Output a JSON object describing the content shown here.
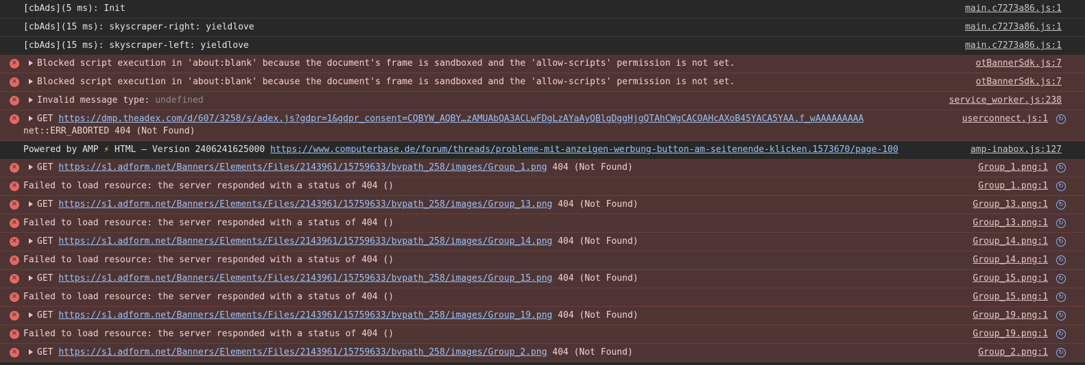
{
  "rows": [
    {
      "text": "[cbAds](5 ms): Init",
      "source": "main.c7273a86.js:1"
    },
    {
      "text": "[cbAds](15 ms): skyscraper-right: yieldlove",
      "source": "main.c7273a86.js:1"
    },
    {
      "text": "[cbAds](15 ms): skyscraper-left: yieldlove",
      "source": "main.c7273a86.js:1"
    },
    {
      "text": "Blocked script execution in 'about:blank' because the document's frame is sandboxed and the 'allow-scripts' permission is not set.",
      "source": "otBannerSdk.js:7"
    },
    {
      "text": "Blocked script execution in 'about:blank' because the document's frame is sandboxed and the 'allow-scripts' permission is not set.",
      "source": "otBannerSdk.js:7"
    },
    {
      "text": "Invalid message type: ",
      "extra": "undefined",
      "source": "service_worker.js:238"
    },
    {
      "text": "GET ",
      "url": "https://dmp.theadex.com/d/607/3258/s/adex.js?gdpr=1&gdpr_consent=CQBYW_AQBY…zAMUAbQA3ACLwFDgLzAYaAyQBlgDggHjgQTAhCWgCACOAHcAXoB45YACA5YAA.f_wAAAAAAAAA",
      "tail": "\nnet::ERR_ABORTED 404 (Not Found)",
      "source": "userconnect.js:1"
    },
    {
      "text": "Powered by AMP ",
      "bolt": "⚡",
      "text2": " HTML – Version 2406241625000 ",
      "url": "https://www.computerbase.de/forum/threads/probleme-mit-anzeigen-werbung-button-am-seitenende-klicken.1573670/page-100",
      "source": "amp-inabox.js:127"
    },
    {
      "text": "GET ",
      "url": "https://s1.adform.net/Banners/Elements/Files/2143961/15759633/bvpath_258/images/Group_1.png",
      "tail": " 404 (Not Found)",
      "source": "Group_1.png:1"
    },
    {
      "text": "Failed to load resource: the server responded with a status of 404 ()",
      "source": "Group_1.png:1"
    },
    {
      "text": "GET ",
      "url": "https://s1.adform.net/Banners/Elements/Files/2143961/15759633/bvpath_258/images/Group_13.png",
      "tail": " 404 (Not Found)",
      "source": "Group_13.png:1"
    },
    {
      "text": "Failed to load resource: the server responded with a status of 404 ()",
      "source": "Group_13.png:1"
    },
    {
      "text": "GET ",
      "url": "https://s1.adform.net/Banners/Elements/Files/2143961/15759633/bvpath_258/images/Group_14.png",
      "tail": " 404 (Not Found)",
      "source": "Group_14.png:1"
    },
    {
      "text": "Failed to load resource: the server responded with a status of 404 ()",
      "source": "Group_14.png:1"
    },
    {
      "text": "GET ",
      "url": "https://s1.adform.net/Banners/Elements/Files/2143961/15759633/bvpath_258/images/Group_15.png",
      "tail": " 404 (Not Found)",
      "source": "Group_15.png:1"
    },
    {
      "text": "Failed to load resource: the server responded with a status of 404 ()",
      "source": "Group_15.png:1"
    },
    {
      "text": "GET ",
      "url": "https://s1.adform.net/Banners/Elements/Files/2143961/15759633/bvpath_258/images/Group_19.png",
      "tail": " 404 (Not Found)",
      "source": "Group_19.png:1"
    },
    {
      "text": "Failed to load resource: the server responded with a status of 404 ()",
      "source": "Group_19.png:1"
    },
    {
      "text": "GET ",
      "url": "https://s1.adform.net/Banners/Elements/Files/2143961/15759633/bvpath_258/images/Group_2.png",
      "tail": " 404 (Not Found)",
      "source": "Group_2.png:1"
    }
  ],
  "colors": {
    "error_bg": "#4e3534",
    "link": "#9dc1f5",
    "error_icon": "#e46962"
  },
  "icons": {
    "error": "error-circle-icon",
    "network": "network-request-icon",
    "expand": "expand-triangle-icon"
  }
}
